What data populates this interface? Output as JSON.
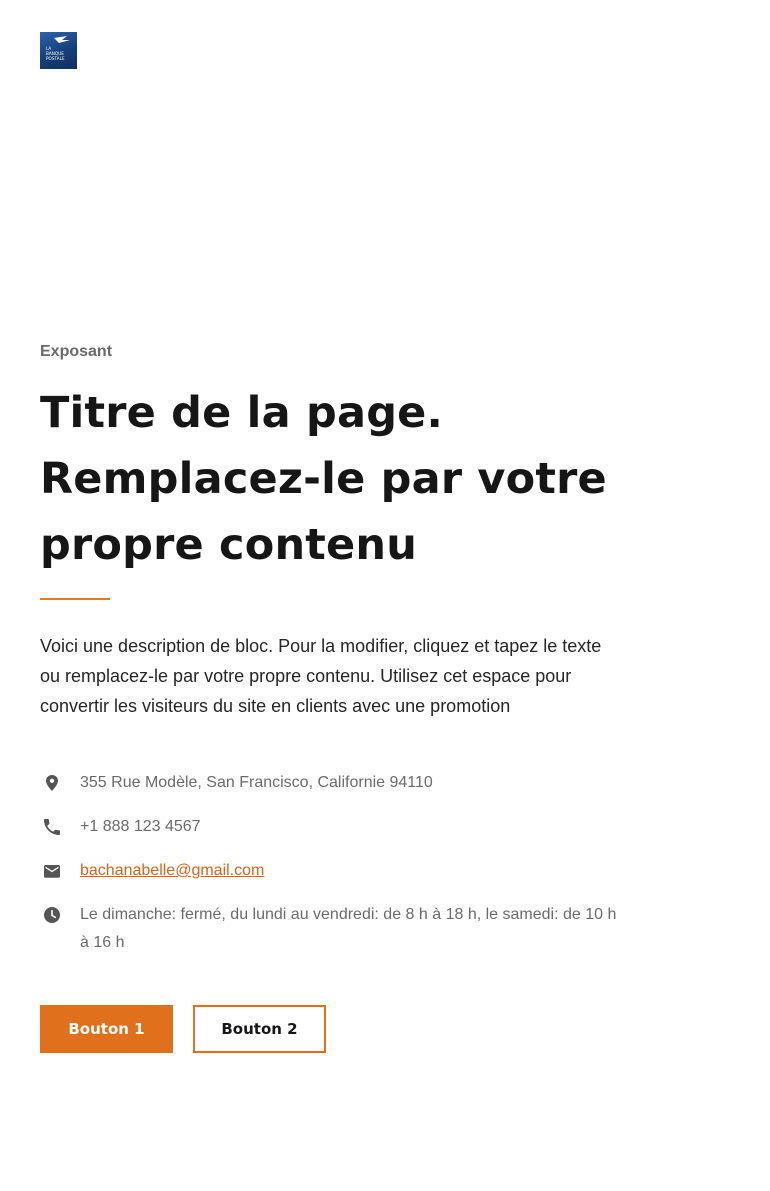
{
  "logo": {
    "name": "La Banque Postale logo",
    "lines": [
      "LA",
      "BANQUE",
      "POSTALE"
    ]
  },
  "hero": {
    "kicker": "Exposant",
    "title": "Titre de la page. Remplacez-le par votre propre contenu",
    "description": "Voici une description de bloc. Pour la modifier, cliquez et tapez le texte ou remplacez-le par votre propre contenu. Utilisez cet espace pour convertir les visiteurs du site en clients avec une promotion"
  },
  "contact": {
    "address": "355 Rue Modèle, San Francisco, Californie 94110",
    "phone": "+1 888 123 4567",
    "email": "bachanabelle@gmail.com",
    "hours": "Le dimanche: fermé, du lundi au vendredi: de 8 h à 18 h, le samedi: de 10 h à 16 h"
  },
  "buttons": {
    "primary": "Bouton 1",
    "secondary": "Bouton 2"
  },
  "colors": {
    "accent": "#e0701c",
    "link": "#d5661a",
    "muted_text": "#6b6b6b",
    "heading": "#161616"
  },
  "icons": {
    "address": "map-pin-icon",
    "phone": "phone-icon",
    "email": "envelope-icon",
    "hours": "clock-icon"
  }
}
